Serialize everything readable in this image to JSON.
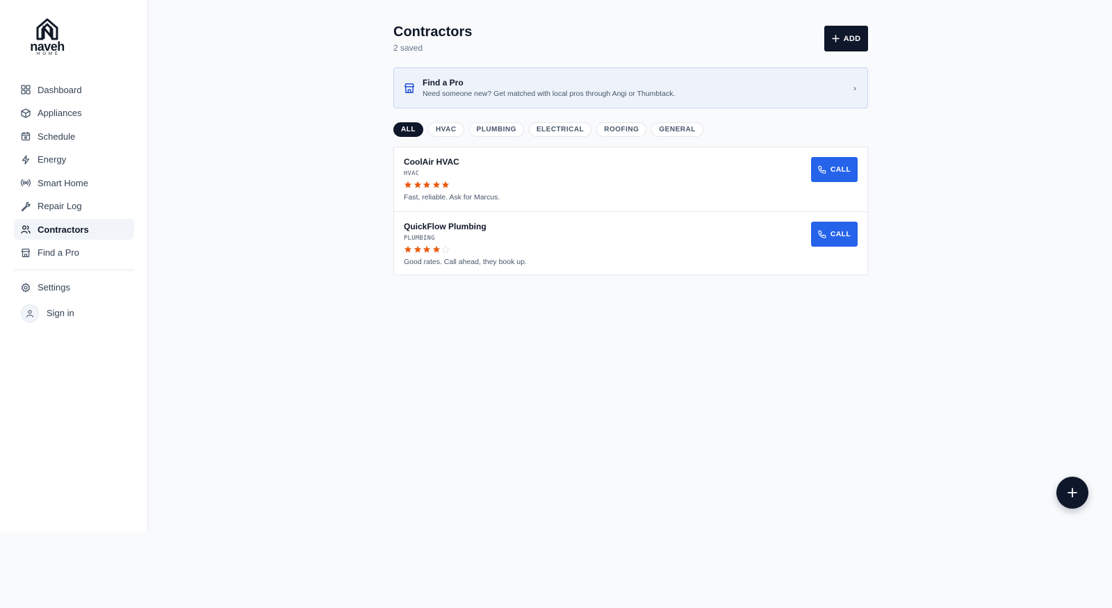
{
  "brand": {
    "name": "naveh",
    "sub": "HOME"
  },
  "sidebar": {
    "items": [
      {
        "label": "Dashboard",
        "icon": "dashboard-icon"
      },
      {
        "label": "Appliances",
        "icon": "box-icon"
      },
      {
        "label": "Schedule",
        "icon": "calendar-icon"
      },
      {
        "label": "Energy",
        "icon": "lightning-icon"
      },
      {
        "label": "Smart Home",
        "icon": "radio-icon"
      },
      {
        "label": "Repair Log",
        "icon": "wrench-icon"
      },
      {
        "label": "Contractors",
        "icon": "users-icon",
        "active": true
      },
      {
        "label": "Find a Pro",
        "icon": "store-icon"
      }
    ],
    "settings": "Settings",
    "signin": "Sign in"
  },
  "header": {
    "title": "Contractors",
    "subtitle": "2 saved",
    "add_label": "ADD"
  },
  "find_pro": {
    "title": "Find a Pro",
    "description": "Need someone new? Get matched with local pros through Angi or Thumbtack.",
    "chevron": "›"
  },
  "filters": [
    "ALL",
    "HVAC",
    "PLUMBING",
    "ELECTRICAL",
    "ROOFING",
    "GENERAL"
  ],
  "contractors": [
    {
      "name": "CoolAir HVAC",
      "trade": "HVAC",
      "rating": 5,
      "note": "Fast, reliable. Ask for Marcus.",
      "call_label": "CALL"
    },
    {
      "name": "QuickFlow Plumbing",
      "trade": "PLUMBING",
      "rating": 4,
      "note": "Good rates. Call ahead, they book up.",
      "call_label": "CALL"
    }
  ],
  "colors": {
    "accent": "#2563eb",
    "dark": "#0f172a",
    "star": "#ea580c",
    "star_empty": "#e5e7eb"
  }
}
